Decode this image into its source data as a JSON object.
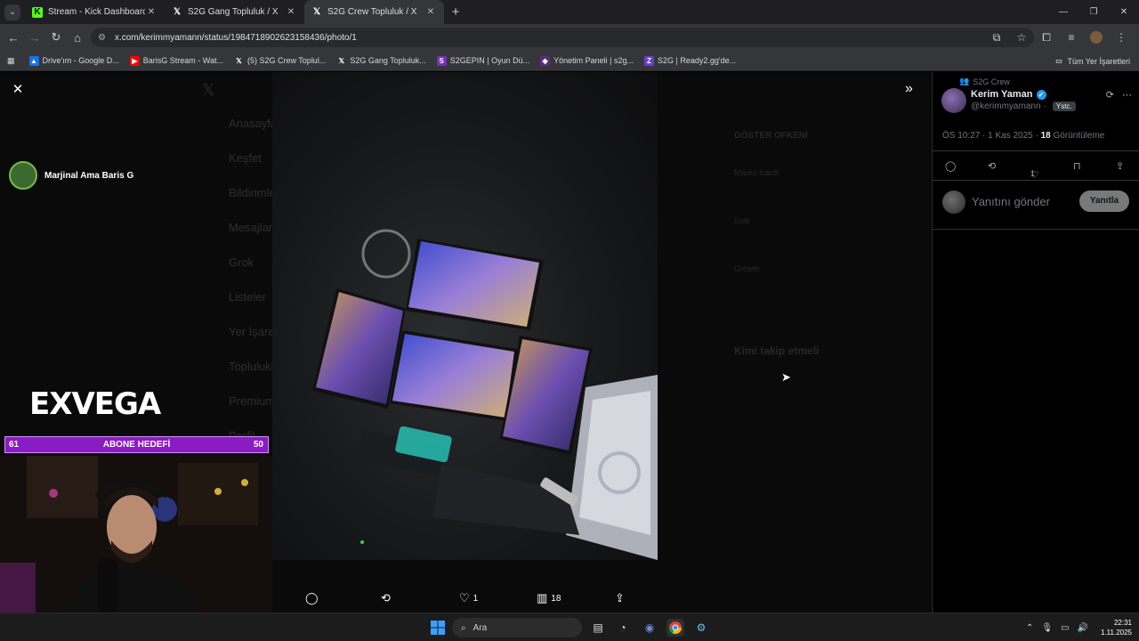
{
  "tabs": [
    {
      "title": "Stream - Kick Dashboard",
      "icon": "kick-icon"
    },
    {
      "title": "S2G Gang Topluluk / X",
      "icon": "x-logo-icon"
    },
    {
      "title": "S2G Crew Topluluk / X",
      "icon": "x-logo-icon",
      "active": true
    }
  ],
  "url": "x.com/kerimmyamann/status/1984718902623158436/photo/1",
  "bookmarks": [
    {
      "label": "Drive'ım - Google D...",
      "icon": "google-drive-icon"
    },
    {
      "label": "BarisG Stream - Wat...",
      "icon": "youtube-icon"
    },
    {
      "label": "(5) S2G Crew Toplul...",
      "icon": "x-logo-icon"
    },
    {
      "label": "S2G Gang Topluluk...",
      "icon": "x-logo-icon"
    },
    {
      "label": "S2GEPIN | Oyun Dü...",
      "icon": "s2gepin-icon"
    },
    {
      "label": "Yönetim Paneli | s2g...",
      "icon": "panel-icon"
    },
    {
      "label": "S2G | Ready2.gg'de...",
      "icon": "ready2-icon"
    }
  ],
  "bookmarks_all": "Tüm Yer İşaretleri",
  "ghost_nav": [
    "Anasayfa",
    "Keşfet",
    "Bildirimler",
    "Mesajlar",
    "Grok",
    "Listeler",
    "Yer İşaretleri",
    "Topluluklar",
    "Premium",
    "Profil"
  ],
  "ghost_right": {
    "heading1": "GÖSTER OFKENI",
    "items": [
      "Mauro Icardi",
      "Sole",
      "Growth"
    ],
    "heading2": "Kimi takip etmeli"
  },
  "stream": {
    "streamer": "Marjinal Ama Baris G",
    "logo": "EXVEGA",
    "goal": {
      "current": "61",
      "label": "ABONE HEDEFİ",
      "target": "50"
    }
  },
  "photo_actions": {
    "replies": "",
    "retweets": "",
    "likes": "1",
    "views": "18"
  },
  "tweet": {
    "community": "S2G Crew",
    "name": "Kerim Yaman",
    "handle": "@kerimmyamann",
    "badge": "Ystc.",
    "time": "ÖS 10:27 · 1 Kas 2025 ·",
    "views_count": "18",
    "views_label": "Görüntüleme",
    "likes": "1",
    "reply_placeholder": "Yanıtını gönder",
    "reply_button": "Yanıtla"
  },
  "taskbar": {
    "search": "Ara",
    "time": "22:31",
    "date": "1.11.2025"
  }
}
